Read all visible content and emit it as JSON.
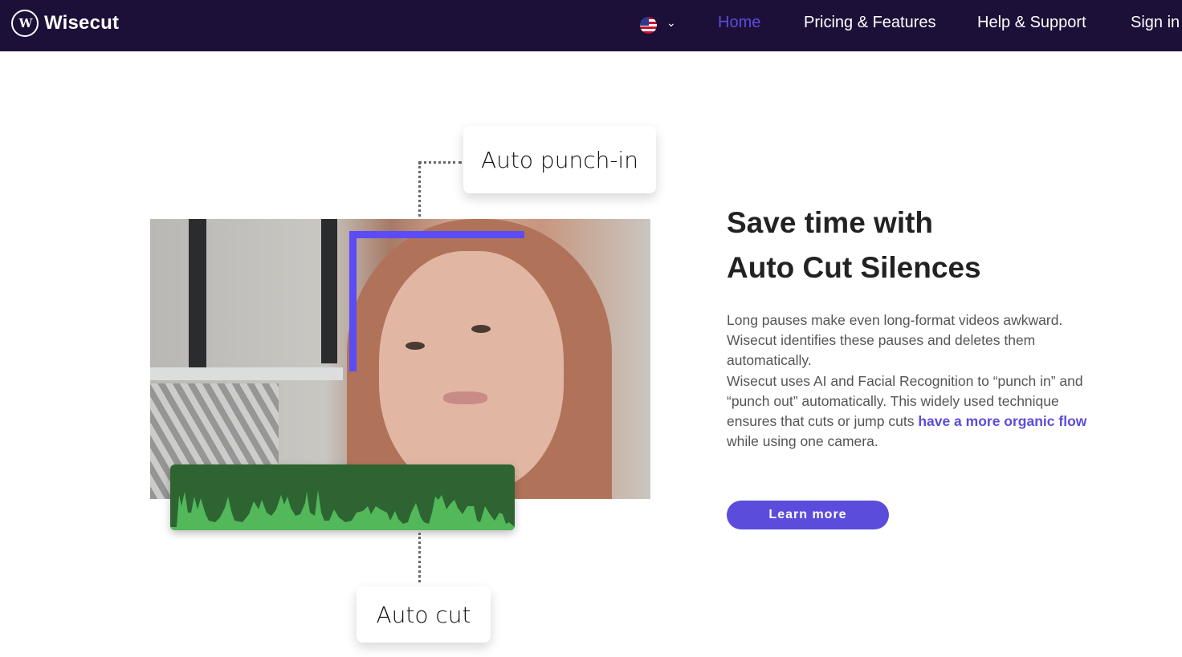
{
  "nav": {
    "brand": "Wisecut",
    "logo_glyph": "W",
    "language_icon": "us-flag-icon",
    "links": [
      {
        "label": "Home",
        "active": true
      },
      {
        "label": "Pricing & Features",
        "active": false
      },
      {
        "label": "Help & Support",
        "active": false
      },
      {
        "label": "Sign in",
        "active": false
      }
    ]
  },
  "illustration": {
    "callout_top": "Auto punch-in",
    "callout_bottom": "Auto cut"
  },
  "content": {
    "title_line1": "Save time with",
    "title_line2": "Auto Cut Silences",
    "paragraph1": "Long pauses make even long-format videos awkward. Wisecut identifies these pauses and deletes them automatically.",
    "paragraph2_start": "Wisecut uses AI and Facial Recognition to “punch in” and “punch out” automatically. This widely used technique ensures that cuts or jump cuts ",
    "paragraph2_highlight": "have a more organic flow",
    "paragraph2_end": " while using one camera.",
    "cta_label": "Learn more"
  },
  "colors": {
    "nav_bg": "#1c1038",
    "accent": "#5b4cdb",
    "wave_dark": "#2e6432",
    "wave_light": "#52b85a"
  }
}
